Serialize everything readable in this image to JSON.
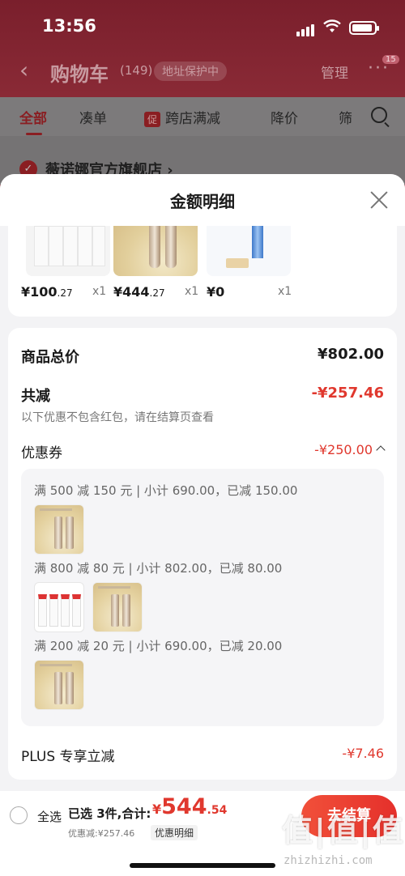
{
  "status_bar": {
    "time": "13:56"
  },
  "nav": {
    "back": "‹",
    "title": "购物车",
    "count": "(149)",
    "address_pill": "地址保护中",
    "manage": "管理",
    "more": "···",
    "msg_badge": "15"
  },
  "tabs": {
    "all": "全部",
    "bundle": "凑单",
    "promo_tag": "促",
    "cross_store": "跨店满减",
    "price_drop": "降价",
    "filter": "筛"
  },
  "store": {
    "name": "薇诺娜官方旗舰店 ›",
    "check": "✓"
  },
  "sheet": {
    "title": "金额明细",
    "products": [
      {
        "price_main": "¥100",
        "price_dec": ".27",
        "qty": "x1"
      },
      {
        "price_main": "¥444",
        "price_dec": ".27",
        "qty": "x1"
      },
      {
        "price_main": "¥0",
        "price_dec": "",
        "qty": "x1"
      }
    ],
    "goods_total_label": "商品总价",
    "goods_total_value": "¥802.00",
    "reduce_label": "共减",
    "reduce_value": "-¥257.46",
    "reduce_note": "以下优惠不包含红包，请在结算页查看",
    "coupon_label": "优惠券",
    "coupon_value": "-¥250.00",
    "coupon_rules": [
      "满 500 减 150 元 | 小计 690.00，已减 150.00",
      "满 800 减 80 元 | 小计 802.00，已减 80.00",
      "满 200 减 20 元 | 小计 690.00，已减 20.00"
    ],
    "plus_label": "PLUS 专享立减",
    "plus_value": "-¥7.46"
  },
  "bottom_bar": {
    "select_all": "全选",
    "selected_summary": "已选 3件,合计:",
    "total_currency": "¥",
    "total_int": "544",
    "total_dec": ".54",
    "discount_text": "优惠减:¥257.46",
    "detail_link": "优惠明细",
    "checkout": "去结算"
  },
  "watermark": {
    "text": "值|值|值",
    "url": "zhizhizhi.com"
  },
  "colors": {
    "accent_red": "#e0382e",
    "dark_red": "#8a1e22"
  }
}
